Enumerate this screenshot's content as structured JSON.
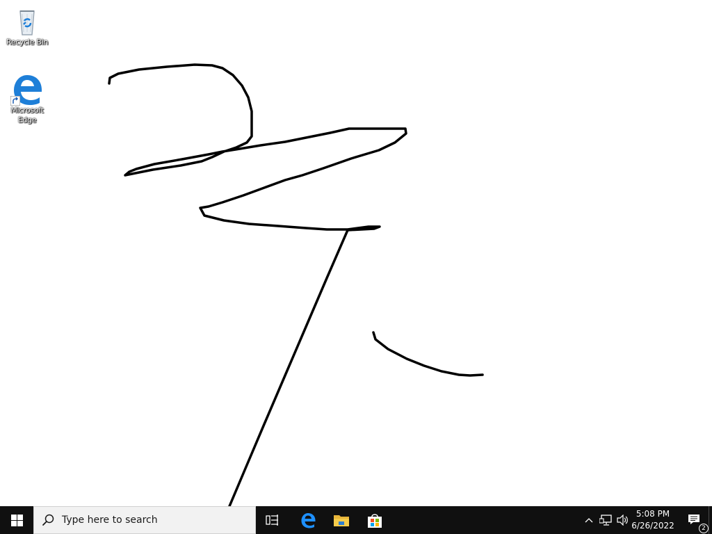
{
  "desktop": {
    "background": "#ffffff",
    "icons": [
      {
        "label": "Recycle Bin",
        "icon": "recycle-bin-icon"
      },
      {
        "label": "Microsoft Edge",
        "icon": "edge-icon"
      }
    ],
    "drawing_stroke_color": "#000000"
  },
  "taskbar": {
    "background": "#101010",
    "start_icon": "windows-logo-icon",
    "search": {
      "placeholder": "Type here to search",
      "icon": "search-icon"
    },
    "pinned": [
      {
        "name": "Task View",
        "icon": "task-view-icon"
      },
      {
        "name": "Microsoft Edge",
        "icon": "edge-icon"
      },
      {
        "name": "File Explorer",
        "icon": "folder-icon"
      },
      {
        "name": "Microsoft Store",
        "icon": "store-icon"
      }
    ],
    "tray": {
      "chevron_icon": "chevron-up-icon",
      "network_icon": "network-icon",
      "volume_icon": "volume-icon",
      "time": "5:08 PM",
      "date": "6/26/2022",
      "notification_icon": "notification-icon",
      "notification_count": "2"
    }
  }
}
